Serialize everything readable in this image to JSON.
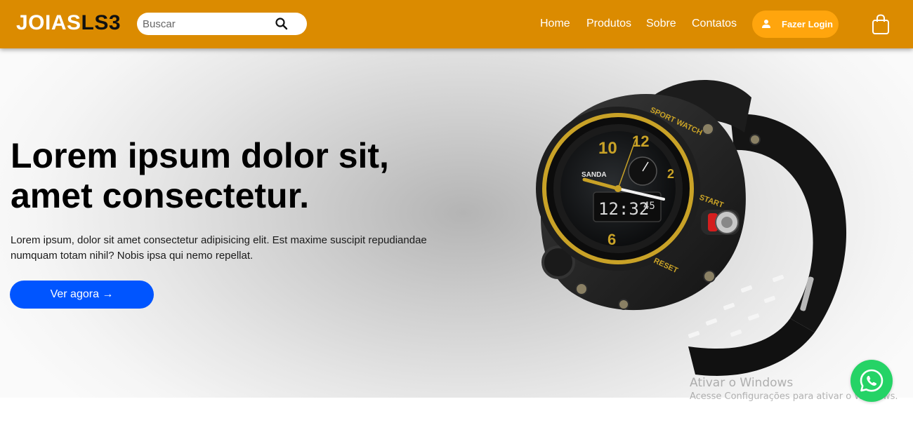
{
  "header": {
    "logo_part1": "JOIAS",
    "logo_part2": "LS3",
    "search_placeholder": "Buscar",
    "nav": [
      "Home",
      "Produtos",
      "Sobre",
      "Contatos"
    ],
    "login_label": "Fazer Login",
    "colors": {
      "bar": "#db8b00",
      "login_button": "#ffa50d"
    }
  },
  "hero": {
    "headline_line1": "Lorem ipsum dolor sit,",
    "headline_line2": "amet consectetur.",
    "description": "Lorem ipsum, dolor sit amet consectetur adipisicing elit. Est maxime suscipit repudiandae numquam totam nihil? Nobis ipsa qui nemo repellat.",
    "cta_label": "Ver agora →",
    "cta_color": "#0055ff",
    "image_icon": "sport-watch-image",
    "watch_text": {
      "bezel": "SPORT WATCH",
      "start": "START",
      "reset": "RESET",
      "brand": "SANDA",
      "numerals": [
        "10",
        "12",
        "2",
        "6"
      ],
      "digital_time": "12:32",
      "digital_seconds": "45"
    }
  },
  "overlay": {
    "windows_title": "Ativar o Windows",
    "windows_subtitle": "Acesse Configurações para ativar o Windows.",
    "whatsapp_icon": "whatsapp-icon",
    "whatsapp_color": "#25d366"
  }
}
